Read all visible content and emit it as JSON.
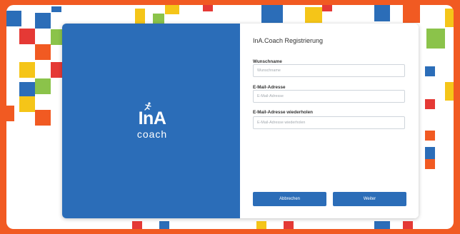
{
  "colors": {
    "border": "#f15a22",
    "brand_panel": "#2b6db8",
    "button": "#2b6db8",
    "tiles": [
      "#2b6db8",
      "#e53935",
      "#f5c518",
      "#8bc34a",
      "#f15a22"
    ]
  },
  "brand": {
    "logo_mark": "InA",
    "logo_word": "coach",
    "logo_icon": "climbing-figure-icon"
  },
  "form": {
    "title": "InA.Coach Registrierung",
    "fields": [
      {
        "label": "Wunschname",
        "placeholder": "Wunschname",
        "value": ""
      },
      {
        "label": "E-Mail-Adresse",
        "placeholder": "E-Mail-Adresse",
        "value": ""
      },
      {
        "label": "E-Mail-Adresse wiederholen",
        "placeholder": "E-Mail-Adresse wiederholen",
        "value": ""
      }
    ],
    "cancel_label": "Abbrechen",
    "next_label": "Weiter"
  }
}
